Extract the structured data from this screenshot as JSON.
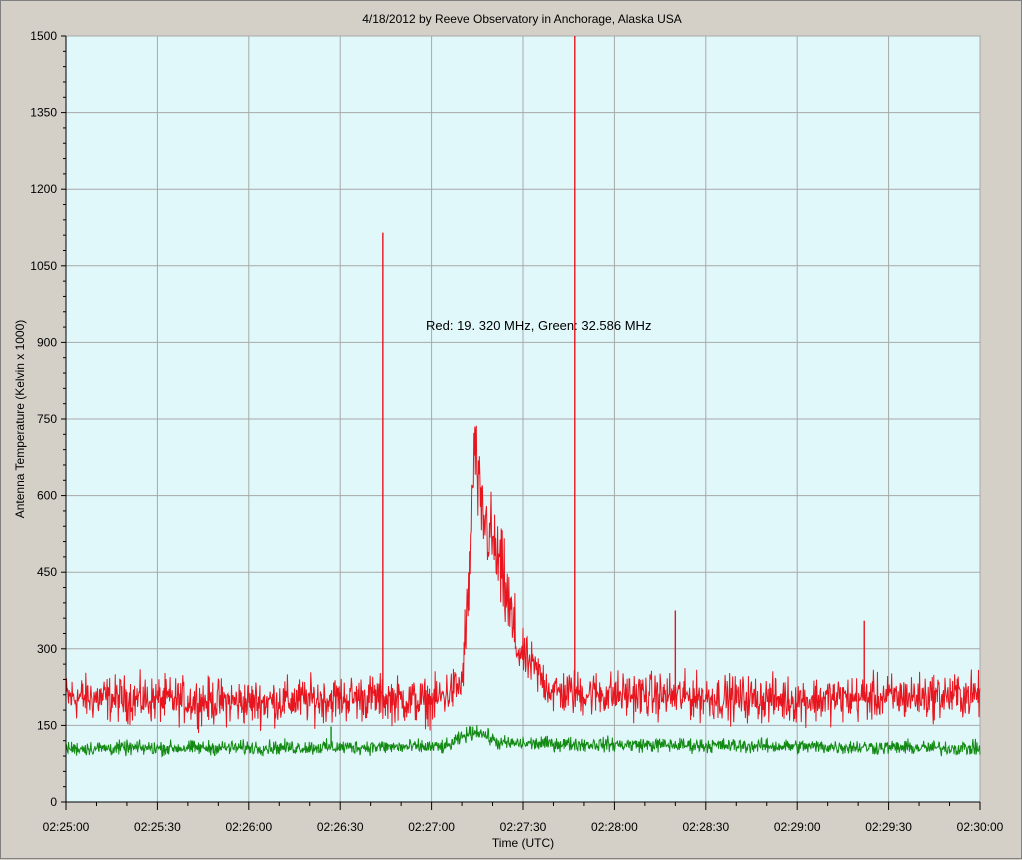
{
  "chart_data": {
    "type": "line",
    "title": "4/18/2012  by  Reeve Observatory  in  Anchorage, Alaska  USA",
    "xlabel": "Time (UTC)",
    "ylabel": "Antenna Temperature (Kelvin x 1000)",
    "annotation": "Red: 19. 320 MHz, Green: 32.586 MHz",
    "x_start": "02:25:00",
    "x_end": "02:30:00",
    "xlim_seconds": [
      0,
      300
    ],
    "ylim": [
      0,
      1500
    ],
    "grid": true,
    "x_ticks": [
      "02:25:00",
      "02:25:30",
      "02:26:00",
      "02:26:30",
      "02:27:00",
      "02:27:30",
      "02:28:00",
      "02:28:30",
      "02:29:00",
      "02:29:30",
      "02:30:00"
    ],
    "y_ticks": [
      0,
      150,
      300,
      450,
      600,
      750,
      900,
      1050,
      1200,
      1350,
      1500
    ],
    "series": [
      {
        "name": "Red: 19. 320 MHz",
        "color": "#e8141e",
        "baseline": 200,
        "noise": 22,
        "x": [
          "02:25:00",
          "02:26:00",
          "02:26:40",
          "02:27:00",
          "02:27:10",
          "02:27:12",
          "02:27:14",
          "02:27:16",
          "02:27:20",
          "02:27:24",
          "02:27:28",
          "02:27:40",
          "02:28:30",
          "02:29:00",
          "02:30:00"
        ],
        "y": [
          205,
          195,
          205,
          195,
          230,
          380,
          700,
          570,
          510,
          420,
          300,
          215,
          205,
          200,
          210
        ],
        "spikes": [
          {
            "x": "02:26:44",
            "y": 1115
          },
          {
            "x": "02:27:47",
            "y": 1500
          },
          {
            "x": "02:28:20",
            "y": 375
          },
          {
            "x": "02:29:22",
            "y": 355
          }
        ]
      },
      {
        "name": "Green: 32.586 MHz",
        "color": "#138a13",
        "baseline": 105,
        "noise": 7,
        "x": [
          "02:25:00",
          "02:27:05",
          "02:27:11",
          "02:27:15",
          "02:27:22",
          "02:30:00"
        ],
        "y": [
          105,
          108,
          130,
          140,
          115,
          105
        ],
        "spikes": [
          {
            "x": "02:26:27",
            "y": 148
          }
        ]
      }
    ]
  }
}
